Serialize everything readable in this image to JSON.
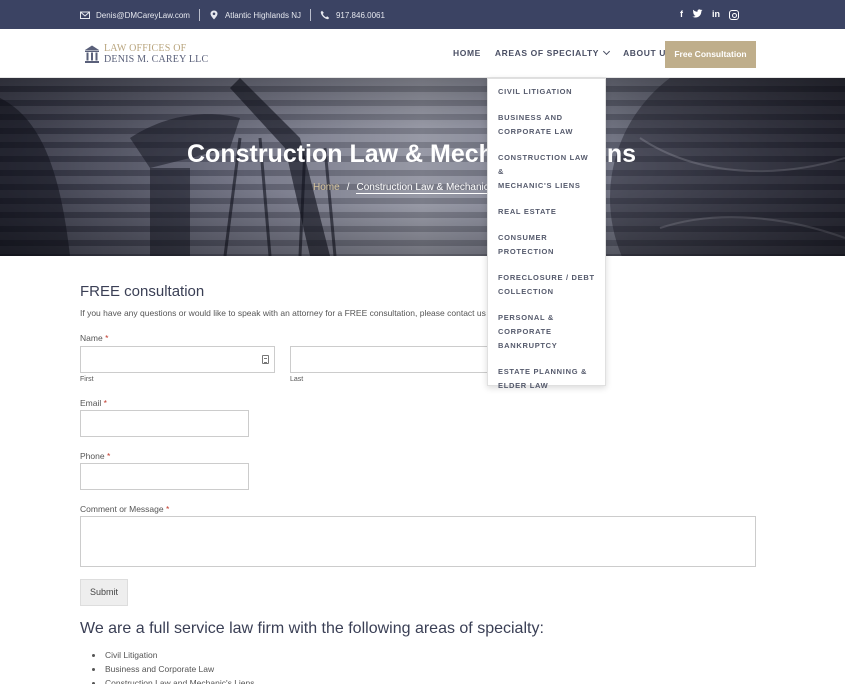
{
  "topbar": {
    "email": "Denis@DMCareyLaw.com",
    "location": "Atlantic Highlands NJ",
    "phone": "917.846.0061",
    "social": [
      "f",
      "twitter-icon",
      "in",
      "instagram-icon"
    ]
  },
  "logo": {
    "line1": "LAW OFFICES OF",
    "line2": "DENIS M. CAREY LLC",
    "icon": "courthouse-icon"
  },
  "nav": {
    "home": "HOME",
    "areas": "AREAS OF SPECIALTY",
    "about": "ABOUT US",
    "cta": "Free Consultation"
  },
  "hero": {
    "title": "Construction Law & Mechanic's Liens",
    "crumb_home": "Home",
    "crumb_sep": "/",
    "crumb_current": "Construction Law & Mechanic's Liens"
  },
  "dropdown": {
    "items": [
      [
        "CIVIL LITIGATION"
      ],
      [
        "BUSINESS AND",
        "CORPORATE LAW"
      ],
      [
        "CONSTRUCTION LAW &",
        "MECHANIC'S LIENS"
      ],
      [
        "REAL ESTATE"
      ],
      [
        "CONSUMER",
        "PROTECTION"
      ],
      [
        "FORECLOSURE / DEBT",
        "COLLECTION"
      ],
      [
        "PERSONAL &",
        "CORPORATE",
        "BANKRUPTCY"
      ],
      [
        "ESTATE PLANNING &",
        "ELDER LAW"
      ]
    ]
  },
  "form": {
    "title": "FREE consultation",
    "intro": "If you have any questions or would like to speak with an attorney for a FREE consultation, please contact us",
    "name_label": "Name",
    "first_label": "First",
    "last_label": "Last",
    "email_label": "Email",
    "phone_label": "Phone",
    "comment_label": "Comment or Message",
    "required_mark": "*",
    "submit": "Submit"
  },
  "areas": {
    "title": "We are a full service law firm with the following areas of specialty:",
    "items": [
      "Civil Litigation",
      "Business and Corporate Law",
      "Construction Law and Mechanic's Liens"
    ]
  }
}
